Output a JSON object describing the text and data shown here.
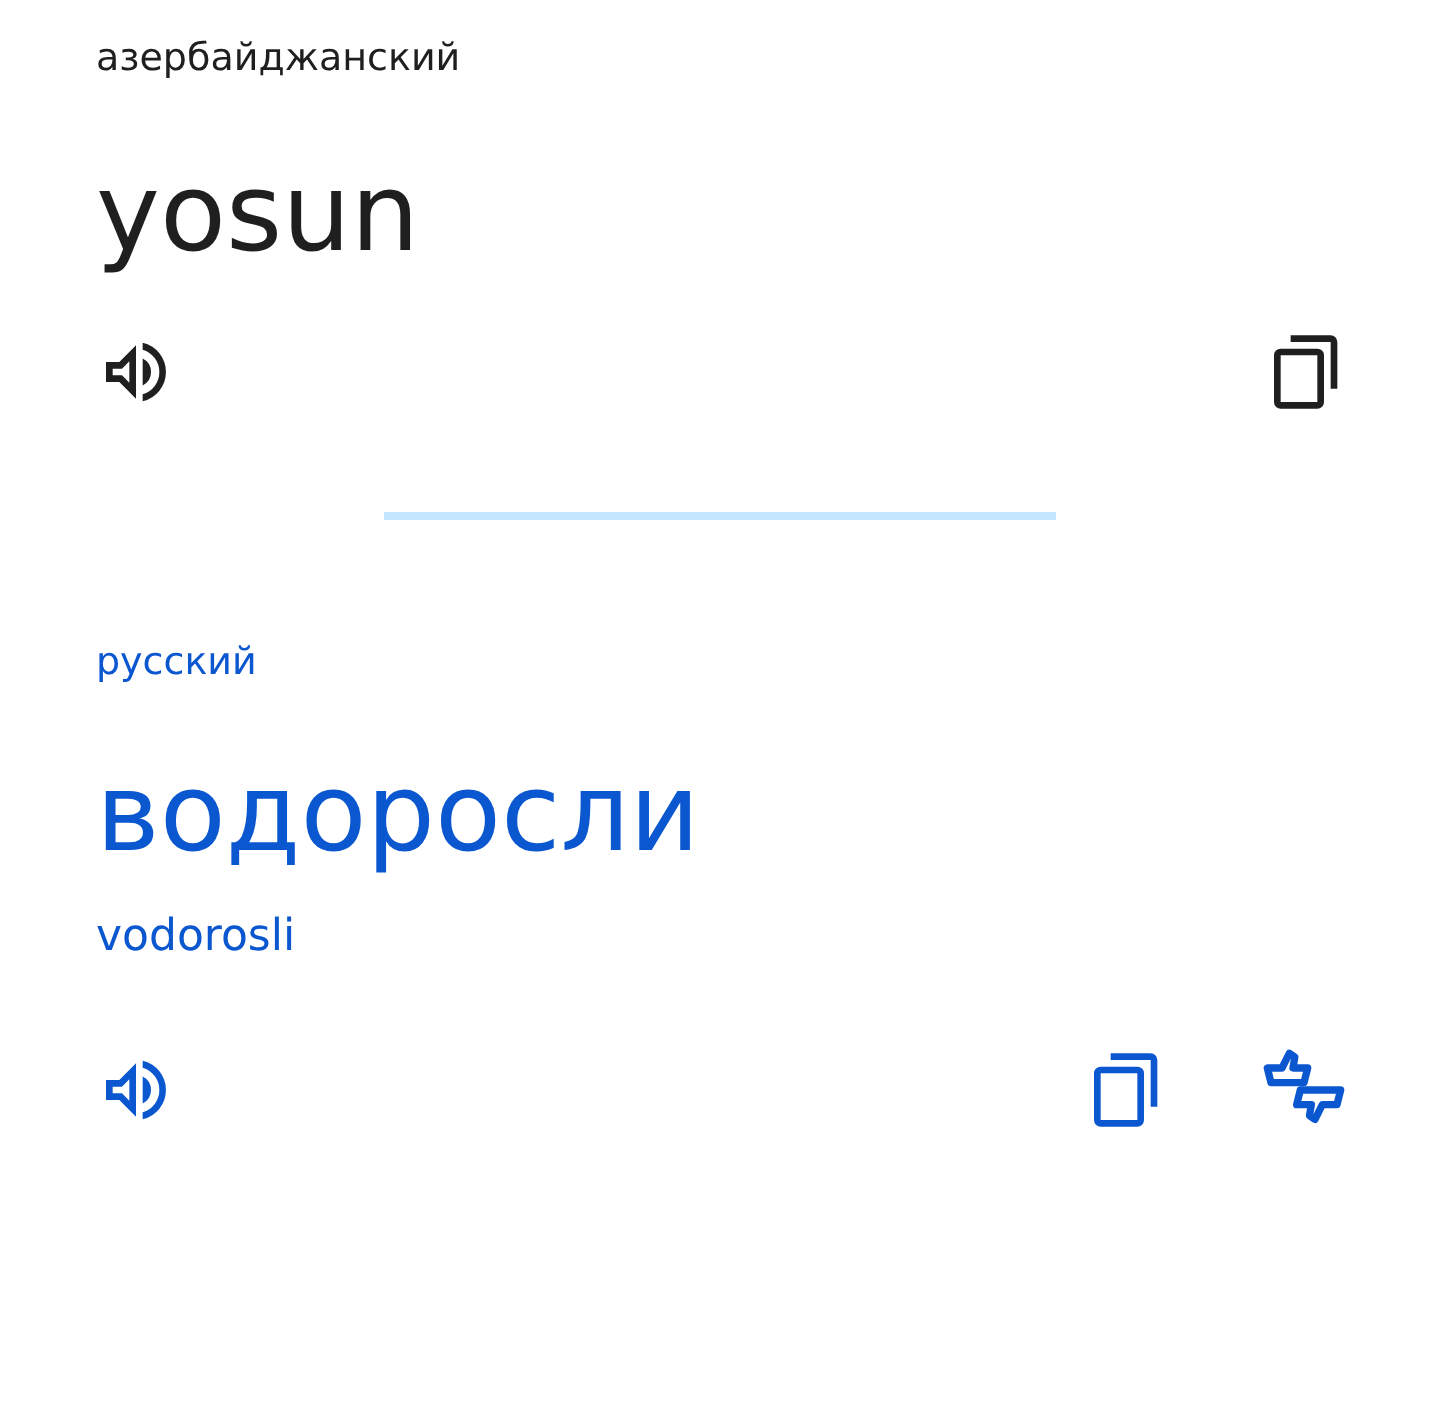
{
  "source": {
    "language": "азербайджанский",
    "text": "yosun"
  },
  "target": {
    "language": "русский",
    "text": "водоросли",
    "transliteration": "vodorosli"
  }
}
